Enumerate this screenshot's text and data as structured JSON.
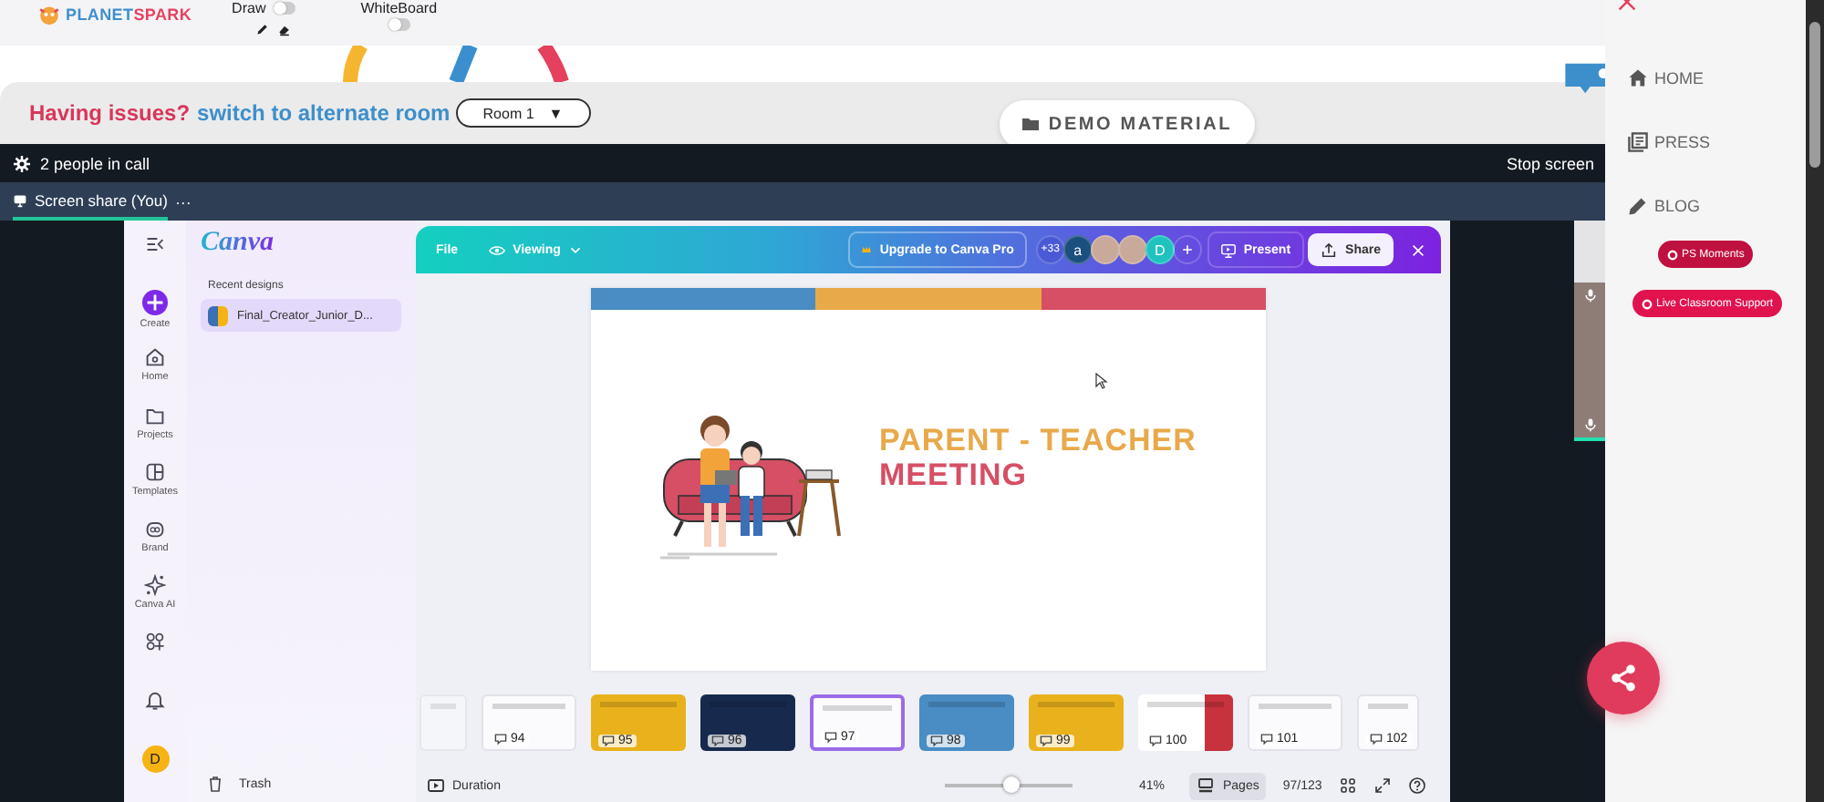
{
  "header": {
    "logo": "PLANETSPARK",
    "draw": {
      "label": "Draw",
      "on": false
    },
    "whiteboard": {
      "label": "WhiteBoard",
      "on": false
    }
  },
  "notice": {
    "issue": "Having issues?",
    "link": "switch to alternate room",
    "room": "Room 1",
    "caret": "▼"
  },
  "demo_button": "DEMO MATERIAL",
  "call_bar": {
    "people": "2 people in call",
    "stop": "Stop screen"
  },
  "share_bar": {
    "label": "Screen share (You)",
    "more": "···"
  },
  "canva": {
    "rail": [
      {
        "kind": "collapse"
      },
      {
        "kind": "create",
        "label": "Create"
      },
      {
        "kind": "home",
        "label": "Home"
      },
      {
        "kind": "folder",
        "label": "Projects"
      },
      {
        "kind": "templates",
        "label": "Templates"
      },
      {
        "kind": "brand",
        "label": "Brand"
      },
      {
        "kind": "ai",
        "label": "Canva AI"
      },
      {
        "kind": "apps"
      },
      {
        "kind": "bell"
      },
      {
        "kind": "avatar",
        "label": "D"
      }
    ],
    "logo": "Canva",
    "recent_title": "Recent designs",
    "recent": [
      {
        "name": "Final_Creator_Junior_D...",
        "selected": true
      }
    ],
    "trash": "Trash",
    "toolbar": {
      "file": "File",
      "viewing": "Viewing",
      "upgrade": "Upgrade to Canva Pro",
      "count": "+33",
      "collaborators": [
        {
          "kind": "letter",
          "text": "a",
          "color": "#1b4f7e"
        },
        {
          "kind": "photo"
        },
        {
          "kind": "photo"
        },
        {
          "kind": "letter",
          "text": "D",
          "color": "#1fc2bf"
        }
      ],
      "present": "Present",
      "share": "Share"
    },
    "slide": {
      "line1": "PARENT - TEACHER",
      "line2": "MEETING"
    },
    "thumbnails": [
      {
        "kind": "light",
        "selected": false
      },
      {
        "kind": "light",
        "number": "94",
        "selected": false
      },
      {
        "kind": "yellow",
        "number": "95",
        "selected": false
      },
      {
        "kind": "navy",
        "number": "96",
        "selected": false
      },
      {
        "kind": "light",
        "number": "97",
        "selected": true
      },
      {
        "kind": "blue",
        "number": "98",
        "selected": false
      },
      {
        "kind": "yellow",
        "number": "99",
        "selected": false
      },
      {
        "kind": "red",
        "number": "100",
        "selected": false
      },
      {
        "kind": "light",
        "number": "101",
        "selected": false
      },
      {
        "kind": "light",
        "number": "102",
        "selected": false
      }
    ],
    "footer": {
      "duration": "Duration",
      "zoom": {
        "level": 0.51,
        "label": "41%"
      },
      "pages": "Pages",
      "page_count": "97/123"
    }
  },
  "sidebar": {
    "items": [
      {
        "kind": "home",
        "label": "HOME"
      },
      {
        "kind": "press",
        "label": "PRESS"
      },
      {
        "kind": "blog",
        "label": "BLOG"
      }
    ],
    "buttons": [
      {
        "label": "PS Moments",
        "kind": "dark"
      },
      {
        "label": "Live Classroom Support",
        "kind": "bright"
      }
    ]
  }
}
